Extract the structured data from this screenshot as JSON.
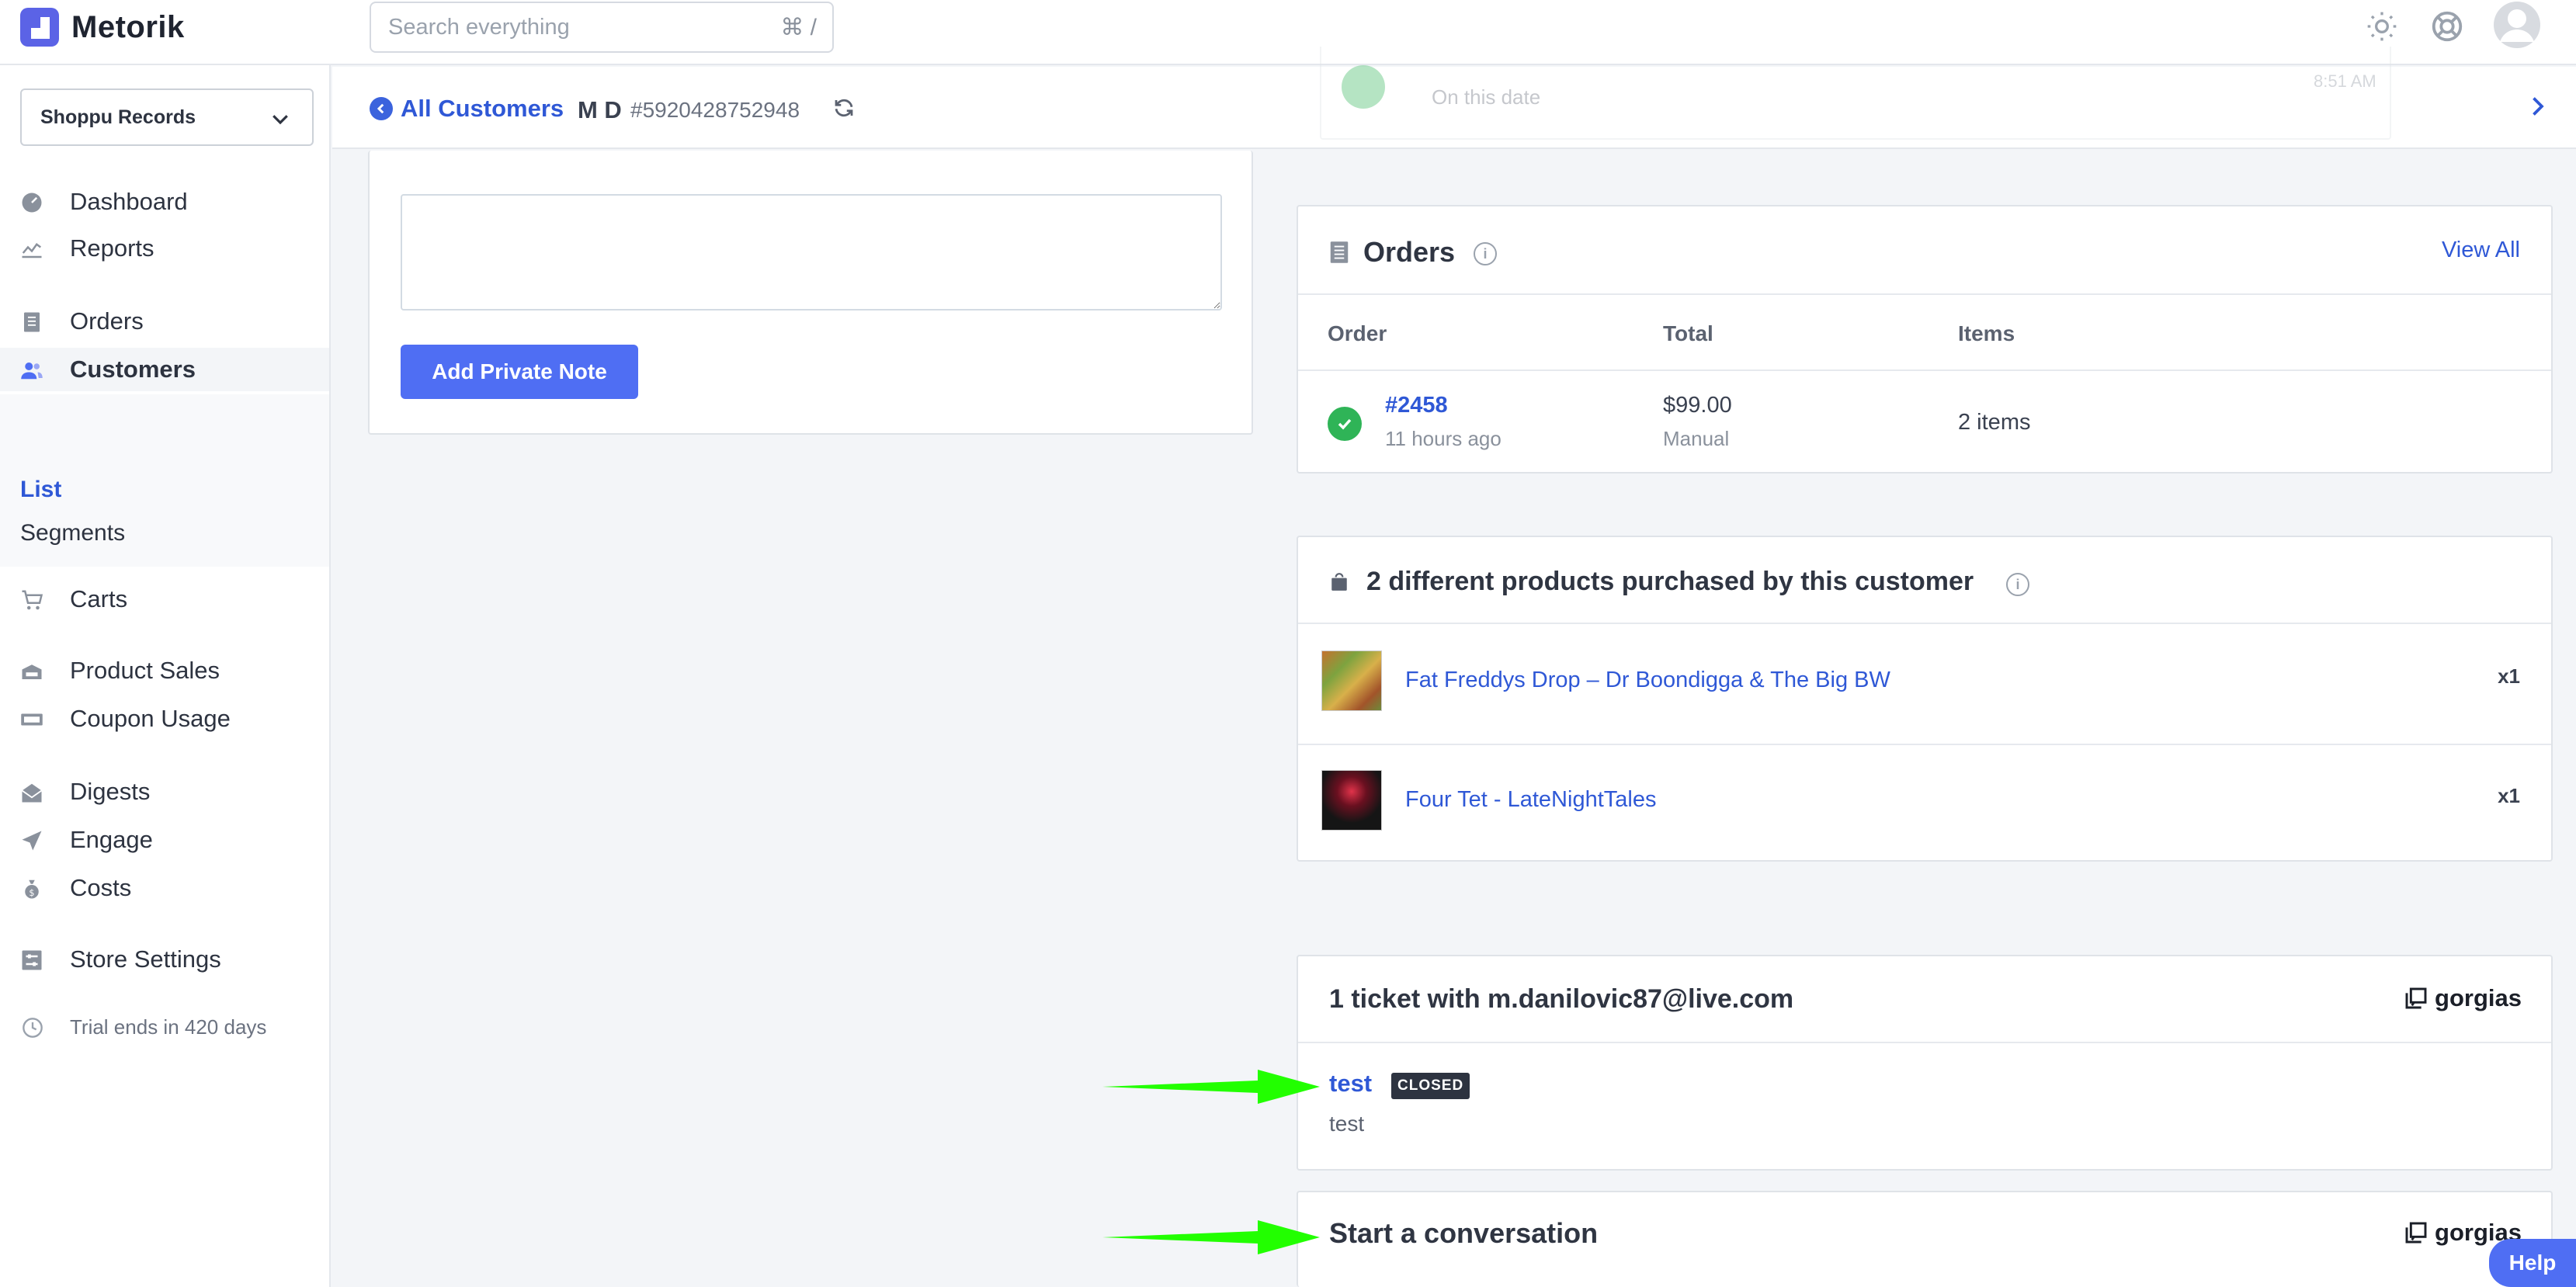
{
  "app": {
    "name": "Metorik"
  },
  "search": {
    "placeholder": "Search everything",
    "shortcut": "⌘ /"
  },
  "sidebar": {
    "store": "Shoppu Records",
    "items": [
      {
        "label": "Dashboard",
        "icon": "dashboard-icon"
      },
      {
        "label": "Reports",
        "icon": "chart-icon"
      },
      {
        "label": "Orders",
        "icon": "orders-icon"
      },
      {
        "label": "Customers",
        "icon": "customers-icon"
      },
      {
        "label": "Carts",
        "icon": "cart-icon"
      },
      {
        "label": "Product Sales",
        "icon": "product-sales-icon"
      },
      {
        "label": "Coupon Usage",
        "icon": "coupon-icon"
      },
      {
        "label": "Digests",
        "icon": "digests-icon"
      },
      {
        "label": "Engage",
        "icon": "engage-icon"
      },
      {
        "label": "Costs",
        "icon": "costs-icon"
      },
      {
        "label": "Store Settings",
        "icon": "settings-icon"
      }
    ],
    "customers_sub": [
      {
        "label": "List"
      },
      {
        "label": "Segments"
      }
    ],
    "trial": "Trial ends in 420 days"
  },
  "header": {
    "back_label": "All Customers",
    "customer_name": "M D",
    "customer_id": "#5920428752948",
    "ghost_subtext": "On this date",
    "ghost_time": "8:51 AM"
  },
  "note": {
    "button_label": "Add Private Note"
  },
  "orders": {
    "title": "Orders",
    "view_all": "View All",
    "columns": [
      "Order",
      "Total",
      "Items"
    ],
    "rows": [
      {
        "number": "#2458",
        "time": "11 hours ago",
        "total": "$99.00",
        "method": "Manual",
        "items": "2 items"
      }
    ]
  },
  "products": {
    "title": "2 different products purchased by this customer",
    "items": [
      {
        "name": "Fat Freddys Drop – Dr Boondigga & The Big BW",
        "qty": "x1"
      },
      {
        "name": "Four Tet - LateNightTales",
        "qty": "x1"
      }
    ]
  },
  "tickets": {
    "title": "1 ticket with m.danilovic87@live.com",
    "brand": "gorgias",
    "items": [
      {
        "subject": "test",
        "status": "CLOSED",
        "body": "test"
      }
    ]
  },
  "conversation": {
    "title": "Start a conversation",
    "brand": "gorgias"
  },
  "help": {
    "label": "Help"
  },
  "colors": {
    "accent": "#4f6ef3",
    "link": "#2f58d6",
    "success": "#2fb457",
    "annotation_arrow": "#22ff00"
  }
}
